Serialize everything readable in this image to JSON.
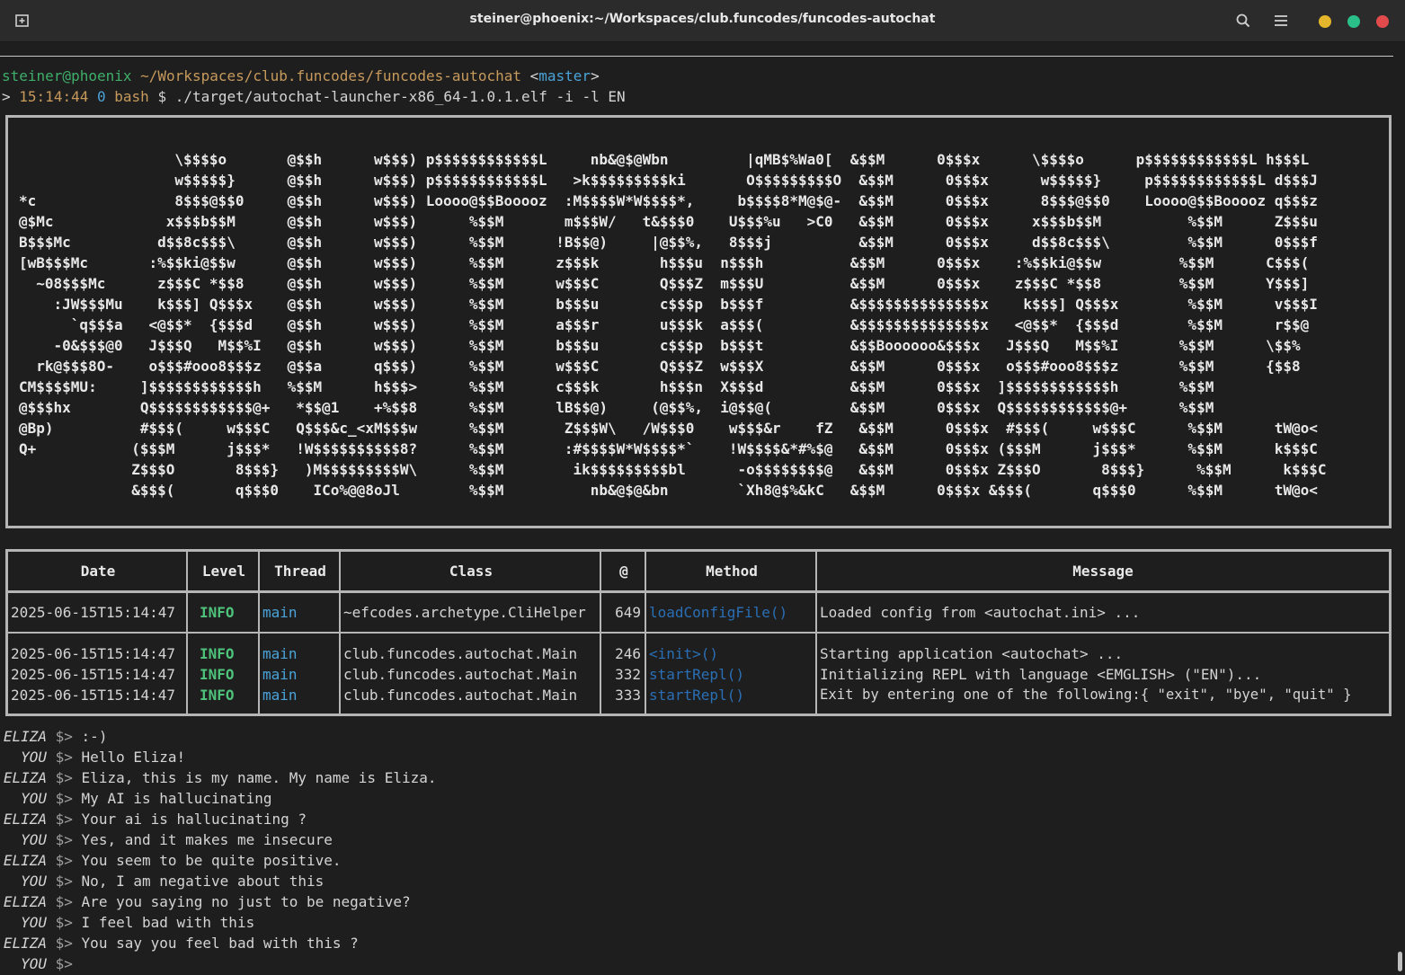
{
  "window": {
    "title": "steiner@phoenix:~/Workspaces/club.funcodes/funcodes-autochat",
    "controls": {
      "minimize_color": "#e5b62b",
      "maximize_color": "#2bbf8a",
      "close_color": "#e24b4b"
    }
  },
  "shell": {
    "user_host": "steiner@phoenix",
    "path": "~/Workspaces/club.funcodes/funcodes-autochat",
    "branch_open": "<",
    "branch": "master",
    "branch_close": ">",
    "prompt_arrow": ">",
    "time": "15:14:44",
    "exit_code": "0",
    "shell_name": "bash",
    "dollar": "$",
    "command": "./target/autochat-launcher-x86_64-1.0.1.elf -i -l EN"
  },
  "banner_ascii": "                  \\$$$$o       @$$h      w$$$) p$$$$$$$$$$$$L     nb&@$@Wbn         |qMB$%Wa0[  &$$M      0$$$x      \\$$$$o      p$$$$$$$$$$$$L h$$$L\n                  w$$$$$}      @$$h      w$$$) p$$$$$$$$$$$$L   >k$$$$$$$$$ki       O$$$$$$$$$O  &$$M      0$$$x      w$$$$$}     p$$$$$$$$$$$$L d$$$J\n*c                8$$$@$$0     @$$h      w$$$) Loooo@$$Booooz  :M$$$$W*W$$$$*,     b$$$$8*M@$@-  &$$M      0$$$x      8$$$@$$0    Loooo@$$Booooz q$$$z\n@$Mc             x$$$b$$M      @$$h      w$$$)      %$$M       m$$$W/   t&$$$0    U$$$%u   >C0   &$$M      0$$$x     x$$$b$$M          %$$M      Z$$$u\nB$$$Mc          d$$8c$$$\\      @$$h      w$$$)      %$$M      !B$$@)     |@$$%,   8$$$j          &$$M      0$$$x     d$$8c$$$\\         %$$M      0$$$f\n[wB$$$Mc       :%$$ki@$$w      @$$h      w$$$)      %$$M      z$$$k       h$$$u  n$$$h          &$$M      0$$$x    :%$$ki@$$w         %$$M      C$$$(\n  ~08$$$Mc      z$$$C *$$8     @$$h      w$$$)      %$$M      w$$$C       Q$$$Z  m$$$U          &$$M      0$$$x    z$$$C *$$8         %$$M      Y$$$]\n    :JW$$$Mu    k$$$] Q$$$x    @$$h      w$$$)      %$$M      b$$$u       c$$$p  b$$$f          &$$$$$$$$$$$$$$x    k$$$] Q$$$x        %$$M      v$$$I\n      `q$$$a   <@$$*  {$$$d    @$$h      w$$$)      %$$M      a$$$r       u$$$k  a$$$(          &$$$$$$$$$$$$$$x   <@$$*  {$$$d        %$$M      r$$@\n    -0&$$$@0   J$$$Q   M$$%I   @$$h      w$$$)      %$$M      b$$$u       c$$$p  b$$$t          &$$Boooooo&$$$x   J$$$Q   M$$%I       %$$M      \\$$%\n  rk@$$$8O-    o$$$#ooo8$$$z   @$$a      q$$$)      %$$M      w$$$C       Q$$$Z  w$$$X          &$$M      0$$$x   o$$$#ooo8$$$z       %$$M      {$$8\nCM$$$$MU:     ]$$$$$$$$$$$$h   %$$M      h$$$>      %$$M      c$$$k       h$$$n  X$$$d          &$$M      0$$$x  ]$$$$$$$$$$$$h       %$$M\n@$$$hx        Q$$$$$$$$$$$$@+   *$$@1    +%$$8      %$$M      lB$$@)     (@$$%,  i@$$@(         &$$M      0$$$x  Q$$$$$$$$$$$$@+      %$$M\n@Bp)          #$$$(     w$$$C   Q$$$&c_<xM$$$w      %$$M       Z$$$W\\   /W$$$0    w$$$&r    fZ   &$$M      0$$$x  #$$$(     w$$$C      %$$M      tW@o<\nQ+           ($$$M      j$$$*   !W$$$$$$$$$$8?      %$$M       :#$$$$W*W$$$$*`    !W$$$$&*#%$@   &$$M      0$$$x ($$$M      j$$$*      %$$M      k$$$C\n             Z$$$O       8$$$}   )M$$$$$$$$$W\\      %$$M        ik$$$$$$$$$bl      -o$$$$$$$$@   &$$M      0$$$x Z$$$O       8$$$}      %$$M      k$$$C\n             &$$$(       q$$$0    ICo%@@8oJl        %$$M          nb&@$@&bn        `Xh8@$%&kC   &$$M      0$$$x &$$$(       q$$$0      %$$M      tW@o<",
  "log_table": {
    "headers": {
      "date": "Date",
      "level": "Level",
      "thread": "Thread",
      "class": "Class",
      "line": "@",
      "method": "Method",
      "message": "Message"
    },
    "rows": [
      {
        "date": "2025-06-15T15:14:47",
        "level": "INFO",
        "thread": "main",
        "class": "~efcodes.archetype.CliHelper",
        "line": "649",
        "method": "loadConfigFile()",
        "message": "Loaded config from <autochat.ini> ..."
      },
      {
        "date": "2025-06-15T15:14:47",
        "level": "INFO",
        "thread": "main",
        "class": "club.funcodes.autochat.Main",
        "line": "246",
        "method": "<init>()",
        "message": "Starting application <autochat> ..."
      },
      {
        "date": "2025-06-15T15:14:47",
        "level": "INFO",
        "thread": "main",
        "class": "club.funcodes.autochat.Main",
        "line": "332",
        "method": "startRepl()",
        "message": "Initializing REPL with language <EMGLISH> (\"EN\")..."
      },
      {
        "date": "2025-06-15T15:14:47",
        "level": "INFO",
        "thread": "main",
        "class": "club.funcodes.autochat.Main",
        "line": "333",
        "method": "startRepl()",
        "message": "Exit by entering one of the following:{ \"exit\", \"bye\", \"quit\" }"
      }
    ]
  },
  "chat": {
    "prompt": "$>",
    "messages": [
      {
        "who": "ELIZA",
        "text": ":-)"
      },
      {
        "who": "YOU",
        "text": "Hello Eliza!"
      },
      {
        "who": "ELIZA",
        "text": "Eliza, this is my name. My name is Eliza."
      },
      {
        "who": "YOU",
        "text": "My AI is hallucinating"
      },
      {
        "who": "ELIZA",
        "text": "Your ai is hallucinating ?"
      },
      {
        "who": "YOU",
        "text": "Yes, and it makes me insecure"
      },
      {
        "who": "ELIZA",
        "text": "You seem to be quite positive."
      },
      {
        "who": "YOU",
        "text": "No, I am negative about this"
      },
      {
        "who": "ELIZA",
        "text": "Are you saying no just to be negative?"
      },
      {
        "who": "YOU",
        "text": "I feel bad with this"
      },
      {
        "who": "ELIZA",
        "text": "You say you feel bad with this ?"
      },
      {
        "who": "YOU",
        "text": ""
      }
    ]
  },
  "icons": {
    "new_tab": "new-tab-icon",
    "search": "search-icon",
    "menu": "hamburger-menu-icon"
  }
}
